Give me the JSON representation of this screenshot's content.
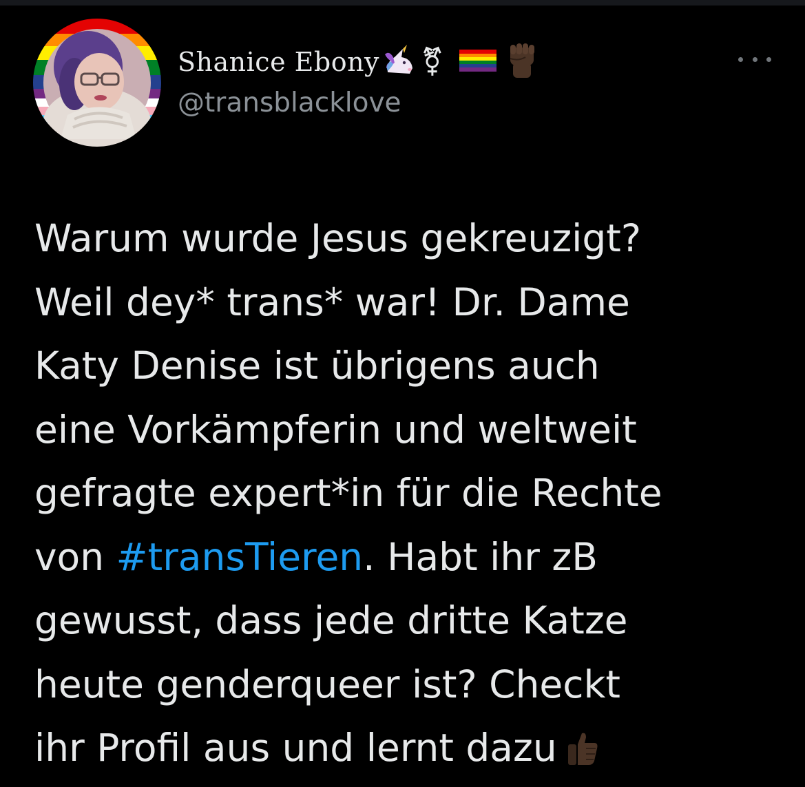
{
  "author": {
    "display_name": "Shanice Ebony",
    "handle": "@transblacklove",
    "name_emojis": [
      "unicorn-icon",
      "transgender-symbol-icon",
      "rainbow-flag-icon",
      "raised-fist-icon"
    ],
    "transgender_symbol": "⚧"
  },
  "tweet": {
    "lines": [
      {
        "text": "Warum wurde Jesus gekreuzigt?"
      },
      {
        "text": "Weil dey* trans* war! Dr. Dame"
      },
      {
        "text": "Katy Denise ist übrigens auch"
      },
      {
        "text": "eine Vorkämpferin und weltweit"
      },
      {
        "text": "gefragte expert*in für die Rechte"
      },
      {
        "before": "von ",
        "hashtag": "#transTieren",
        "after": ". Habt ihr zB"
      },
      {
        "text": "gewusst, dass jede dritte Katze"
      },
      {
        "text": "heute genderqueer ist? Checkt"
      },
      {
        "text": "ihr Profil aus und lernt dazu",
        "trailing_icon": "thumbs-up-icon"
      }
    ]
  },
  "colors": {
    "background": "#000000",
    "text": "#e7e9ea",
    "handle": "#8b9197",
    "hashtag": "#1d9bf0"
  }
}
